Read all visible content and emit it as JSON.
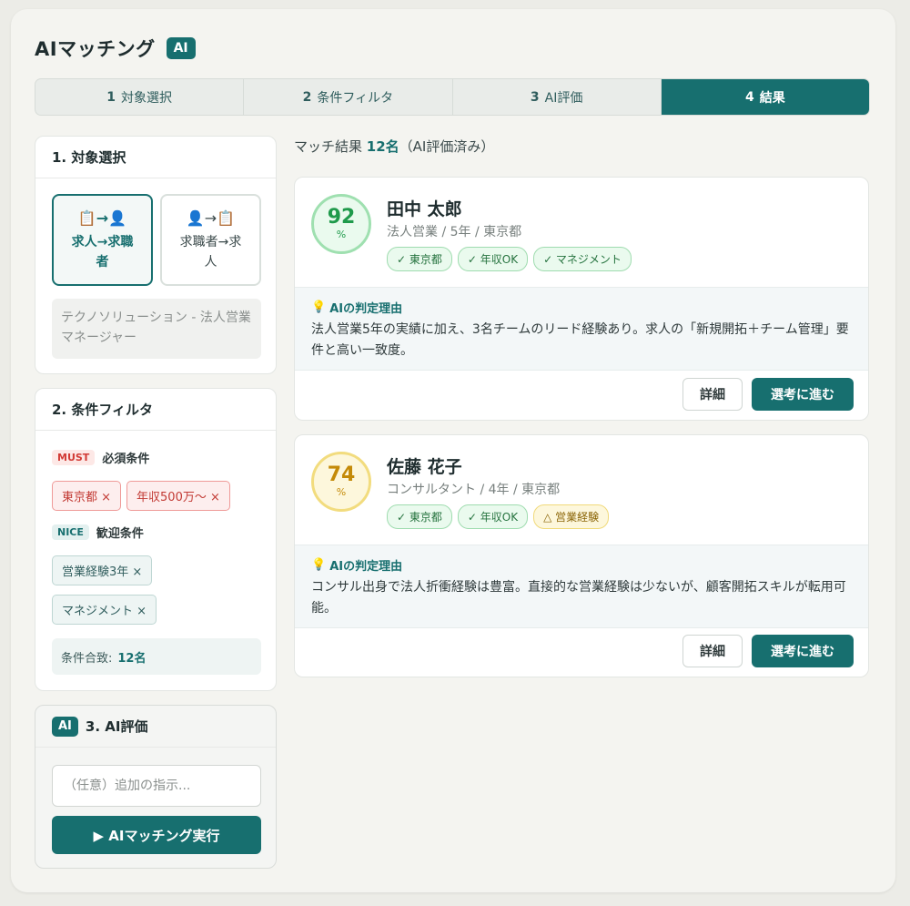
{
  "header": {
    "title": "AIマッチング",
    "badge": "AI"
  },
  "steps": [
    {
      "num": "1",
      "label": "対象選択",
      "active": false
    },
    {
      "num": "2",
      "label": "条件フィルタ",
      "active": false
    },
    {
      "num": "3",
      "label": "AI評価",
      "active": false
    },
    {
      "num": "4",
      "label": "結果",
      "active": true
    }
  ],
  "panel1": {
    "title": "1. 対象選択",
    "option_a": {
      "icon": "📋→👤",
      "label": "求人→求職者",
      "selected": true
    },
    "option_b": {
      "icon": "👤→📋",
      "label": "求職者→求人",
      "selected": false
    },
    "selected_job": "テクノソリューション - 法人営業マネージャー"
  },
  "panel2": {
    "title": "2. 条件フィルタ",
    "must": {
      "tag": "MUST",
      "label": "必須条件",
      "chips": [
        "東京都 ×",
        "年収500万〜 ×"
      ]
    },
    "nice": {
      "tag": "NICE",
      "label": "歓迎条件",
      "chips": [
        "営業経験3年 ×",
        "マネジメント ×"
      ]
    },
    "match_label": "条件合致:",
    "match_count": "12名"
  },
  "panel3": {
    "badge": "AI",
    "title": "3. AI評価",
    "input_placeholder": "（任意）追加の指示...",
    "run_label": "▶ AIマッチング実行"
  },
  "results": {
    "prefix": "マッチ結果",
    "count": "12名",
    "suffix": "（AI評価済み）"
  },
  "candidates": [
    {
      "score": "92",
      "score_unit": "%",
      "score_level": "high",
      "name": "田中 太郎",
      "subtitle": "法人営業 / 5年 / 東京都",
      "tags": [
        {
          "text": "✓ 東京都",
          "status": "ok"
        },
        {
          "text": "✓ 年収OK",
          "status": "ok"
        },
        {
          "text": "✓ マネジメント",
          "status": "ok"
        }
      ],
      "reason_title": "AIの判定理由",
      "reason_icon": "💡",
      "reason": "法人営業5年の実績に加え、3名チームのリード経験あり。求人の「新規開拓＋チーム管理」要件と高い一致度。",
      "detail_label": "詳細",
      "proceed_label": "選考に進む"
    },
    {
      "score": "74",
      "score_unit": "%",
      "score_level": "mid",
      "name": "佐藤 花子",
      "subtitle": "コンサルタント / 4年 / 東京都",
      "tags": [
        {
          "text": "✓ 東京都",
          "status": "ok"
        },
        {
          "text": "✓ 年収OK",
          "status": "ok"
        },
        {
          "text": "△ 営業経験",
          "status": "warn"
        }
      ],
      "reason_title": "AIの判定理由",
      "reason_icon": "💡",
      "reason": "コンサル出身で法人折衝経験は豊富。直接的な営業経験は少ないが、顧客開拓スキルが転用可能。",
      "detail_label": "詳細",
      "proceed_label": "選考に進む"
    }
  ]
}
